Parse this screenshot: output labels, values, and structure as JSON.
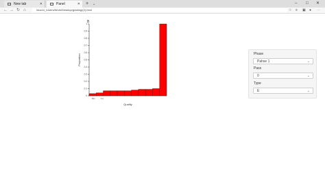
{
  "browser": {
    "tabs": [
      {
        "label": "New tab",
        "active": false
      },
      {
        "label": "Panel",
        "active": true
      }
    ],
    "new_tab_label": "+",
    "tab_dropdown_label": "⌄",
    "window_controls": [
      "–",
      "□",
      "✕"
    ],
    "address": "/doc/ct_/Users/Work/Desktop/grading/(2).html",
    "icons": [
      "back-icon",
      "forward-icon",
      "refresh-icon",
      "home-icon",
      "star-icon",
      "favorites-icon",
      "collections-icon",
      "profile-icon",
      "more-icon"
    ]
  },
  "chart_data": {
    "type": "bar",
    "title": "B",
    "xlabel": "Quality",
    "ylabel": "Proportion",
    "ylim": [
      0,
      1
    ],
    "yticks": [
      0,
      0.1,
      0.2,
      0.3,
      0.4,
      0.5,
      0.6,
      0.7,
      0.8,
      0.9,
      1
    ],
    "xtick_labels": [
      "Min",
      "1st"
    ],
    "values": [
      0.03,
      0.04,
      0.07,
      0.07,
      0.07,
      0.07,
      0.08,
      0.09,
      0.09,
      0.1,
      1.0
    ],
    "bar_color": "#ff0000",
    "grid": false
  },
  "sidebar": {
    "fields": [
      {
        "label": "Phase",
        "value": "Pahse 1"
      },
      {
        "label": "Pass",
        "value": "0"
      },
      {
        "label": "Type",
        "value": "E"
      }
    ]
  },
  "colors": {
    "tabbar": "#dedede",
    "toolbar": "#f7f7f7",
    "sidebar_bg": "#f5f5f5",
    "bar": "#ff0000"
  }
}
